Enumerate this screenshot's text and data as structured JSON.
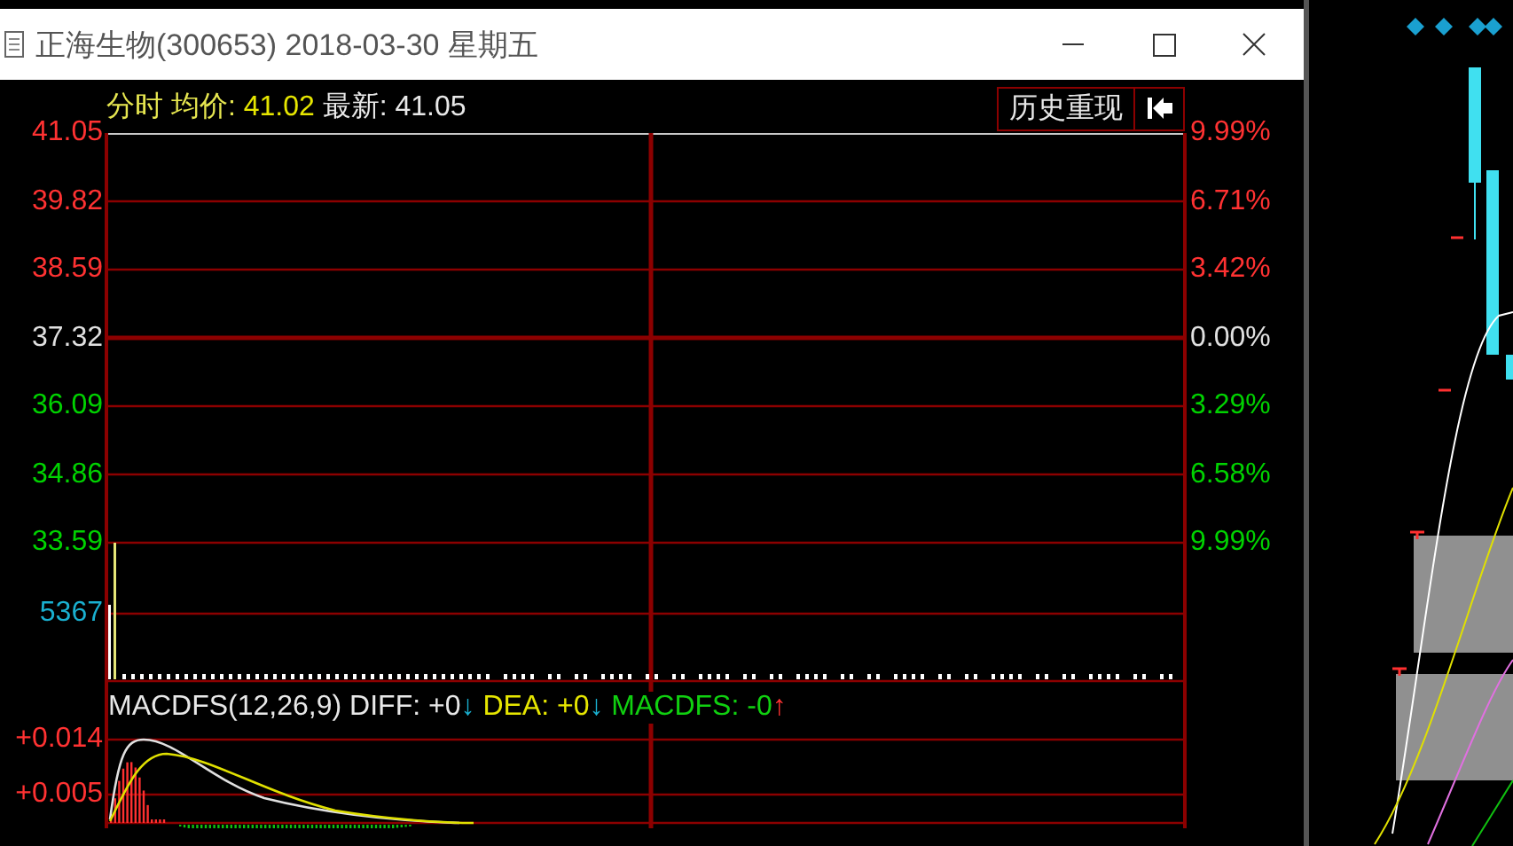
{
  "window": {
    "title": "正海生物(300653) 2018-03-30 星期五"
  },
  "header": {
    "mode": "分时",
    "avg_label": "均价:",
    "avg": "41.02",
    "latest_label": "最新:",
    "latest": "41.05",
    "replay_button": "历史重现"
  },
  "price_axis": [
    {
      "label": "41.05",
      "kind": "up"
    },
    {
      "label": "39.82",
      "kind": "up"
    },
    {
      "label": "38.59",
      "kind": "up"
    },
    {
      "label": "37.32",
      "kind": "flat"
    },
    {
      "label": "36.09",
      "kind": "down"
    },
    {
      "label": "34.86",
      "kind": "down"
    },
    {
      "label": "33.59",
      "kind": "down"
    }
  ],
  "percent_axis": [
    {
      "label": "9.99%",
      "kind": "up"
    },
    {
      "label": "6.71%",
      "kind": "up"
    },
    {
      "label": "3.42%",
      "kind": "up"
    },
    {
      "label": "0.00%",
      "kind": "flat"
    },
    {
      "label": "3.29%",
      "kind": "down"
    },
    {
      "label": "6.58%",
      "kind": "down"
    },
    {
      "label": "9.99%",
      "kind": "down"
    }
  ],
  "volume_axis": {
    "label": "5367"
  },
  "macd": {
    "title": "MACDFS(12,26,9)",
    "ticks": [
      "+0.014",
      "+0.005"
    ],
    "items": [
      {
        "label": "DIFF:",
        "value": "+0",
        "arrow": "↓",
        "kind": "falling",
        "color": "#e8e8e8"
      },
      {
        "label": "DEA:",
        "value": "+0",
        "arrow": "↓",
        "kind": "falling",
        "color": "#e6e600"
      },
      {
        "label": "MACDFS:",
        "value": "-0",
        "arrow": "↑",
        "kind": "rising",
        "color": "#10d010"
      }
    ]
  }
}
